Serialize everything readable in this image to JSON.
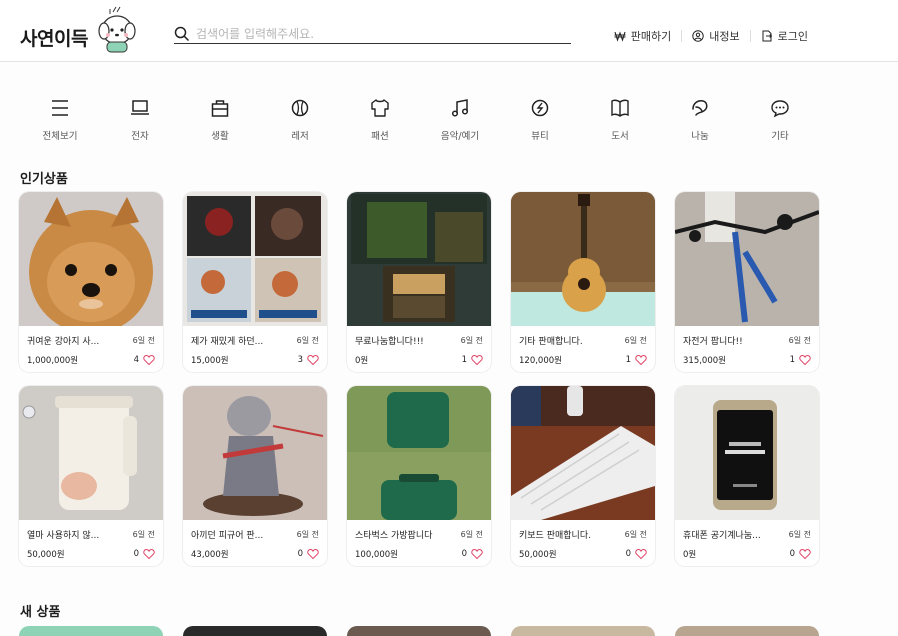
{
  "header": {
    "logo_text": "사연이득",
    "search_placeholder": "검색어를 입력해주세요.",
    "nav": [
      {
        "label": "판매하기",
        "icon": "won-icon"
      },
      {
        "label": "내정보",
        "icon": "user-icon"
      },
      {
        "label": "로그인",
        "icon": "login-icon"
      }
    ]
  },
  "categories": [
    {
      "label": "전체보기",
      "icon": "menu-icon"
    },
    {
      "label": "전자",
      "icon": "laptop-icon"
    },
    {
      "label": "생활",
      "icon": "bag-icon"
    },
    {
      "label": "레저",
      "icon": "ball-icon"
    },
    {
      "label": "패션",
      "icon": "shirt-icon"
    },
    {
      "label": "음악/예기",
      "icon": "music-icon"
    },
    {
      "label": "뷰티",
      "icon": "beauty-icon"
    },
    {
      "label": "도서",
      "icon": "book-icon"
    },
    {
      "label": "나눔",
      "icon": "share-icon"
    },
    {
      "label": "기타",
      "icon": "chat-icon"
    }
  ],
  "popular": {
    "title": "인기상품",
    "items": [
      {
        "name": "귀여운 강아지 사...",
        "time": "6일 전",
        "price": "1,000,000원",
        "likes": "4",
        "image": "dog"
      },
      {
        "name": "제가 재밌게 하던...",
        "time": "6일 전",
        "price": "15,000원",
        "likes": "3",
        "image": "games"
      },
      {
        "name": "무료나눔합니다!!!",
        "time": "6일 전",
        "price": "0원",
        "likes": "1",
        "image": "boardgame"
      },
      {
        "name": "기타 판매합니다.",
        "time": "6일 전",
        "price": "120,000원",
        "likes": "1",
        "image": "guitar"
      },
      {
        "name": "자전거 팝니다!!",
        "time": "6일 전",
        "price": "315,000원",
        "likes": "1",
        "image": "bike"
      },
      {
        "name": "열마 사용하지 않...",
        "time": "6일 전",
        "price": "50,000원",
        "likes": "0",
        "image": "kettle"
      },
      {
        "name": "아끼던 피규어 판...",
        "time": "6일 전",
        "price": "43,000원",
        "likes": "0",
        "image": "figure"
      },
      {
        "name": "스타벅스 가방팝니다",
        "time": "6일 전",
        "price": "100,000원",
        "likes": "0",
        "image": "case"
      },
      {
        "name": "키보드 판매합니다.",
        "time": "6일 전",
        "price": "50,000원",
        "likes": "0",
        "image": "keyboard"
      },
      {
        "name": "휴대폰 공기계나눔...",
        "time": "6일 전",
        "price": "0원",
        "likes": "0",
        "image": "phone"
      }
    ]
  },
  "new": {
    "title": "새 상품"
  },
  "colors": {
    "heart": "#e0486a",
    "accent": "#1a1a1a"
  }
}
